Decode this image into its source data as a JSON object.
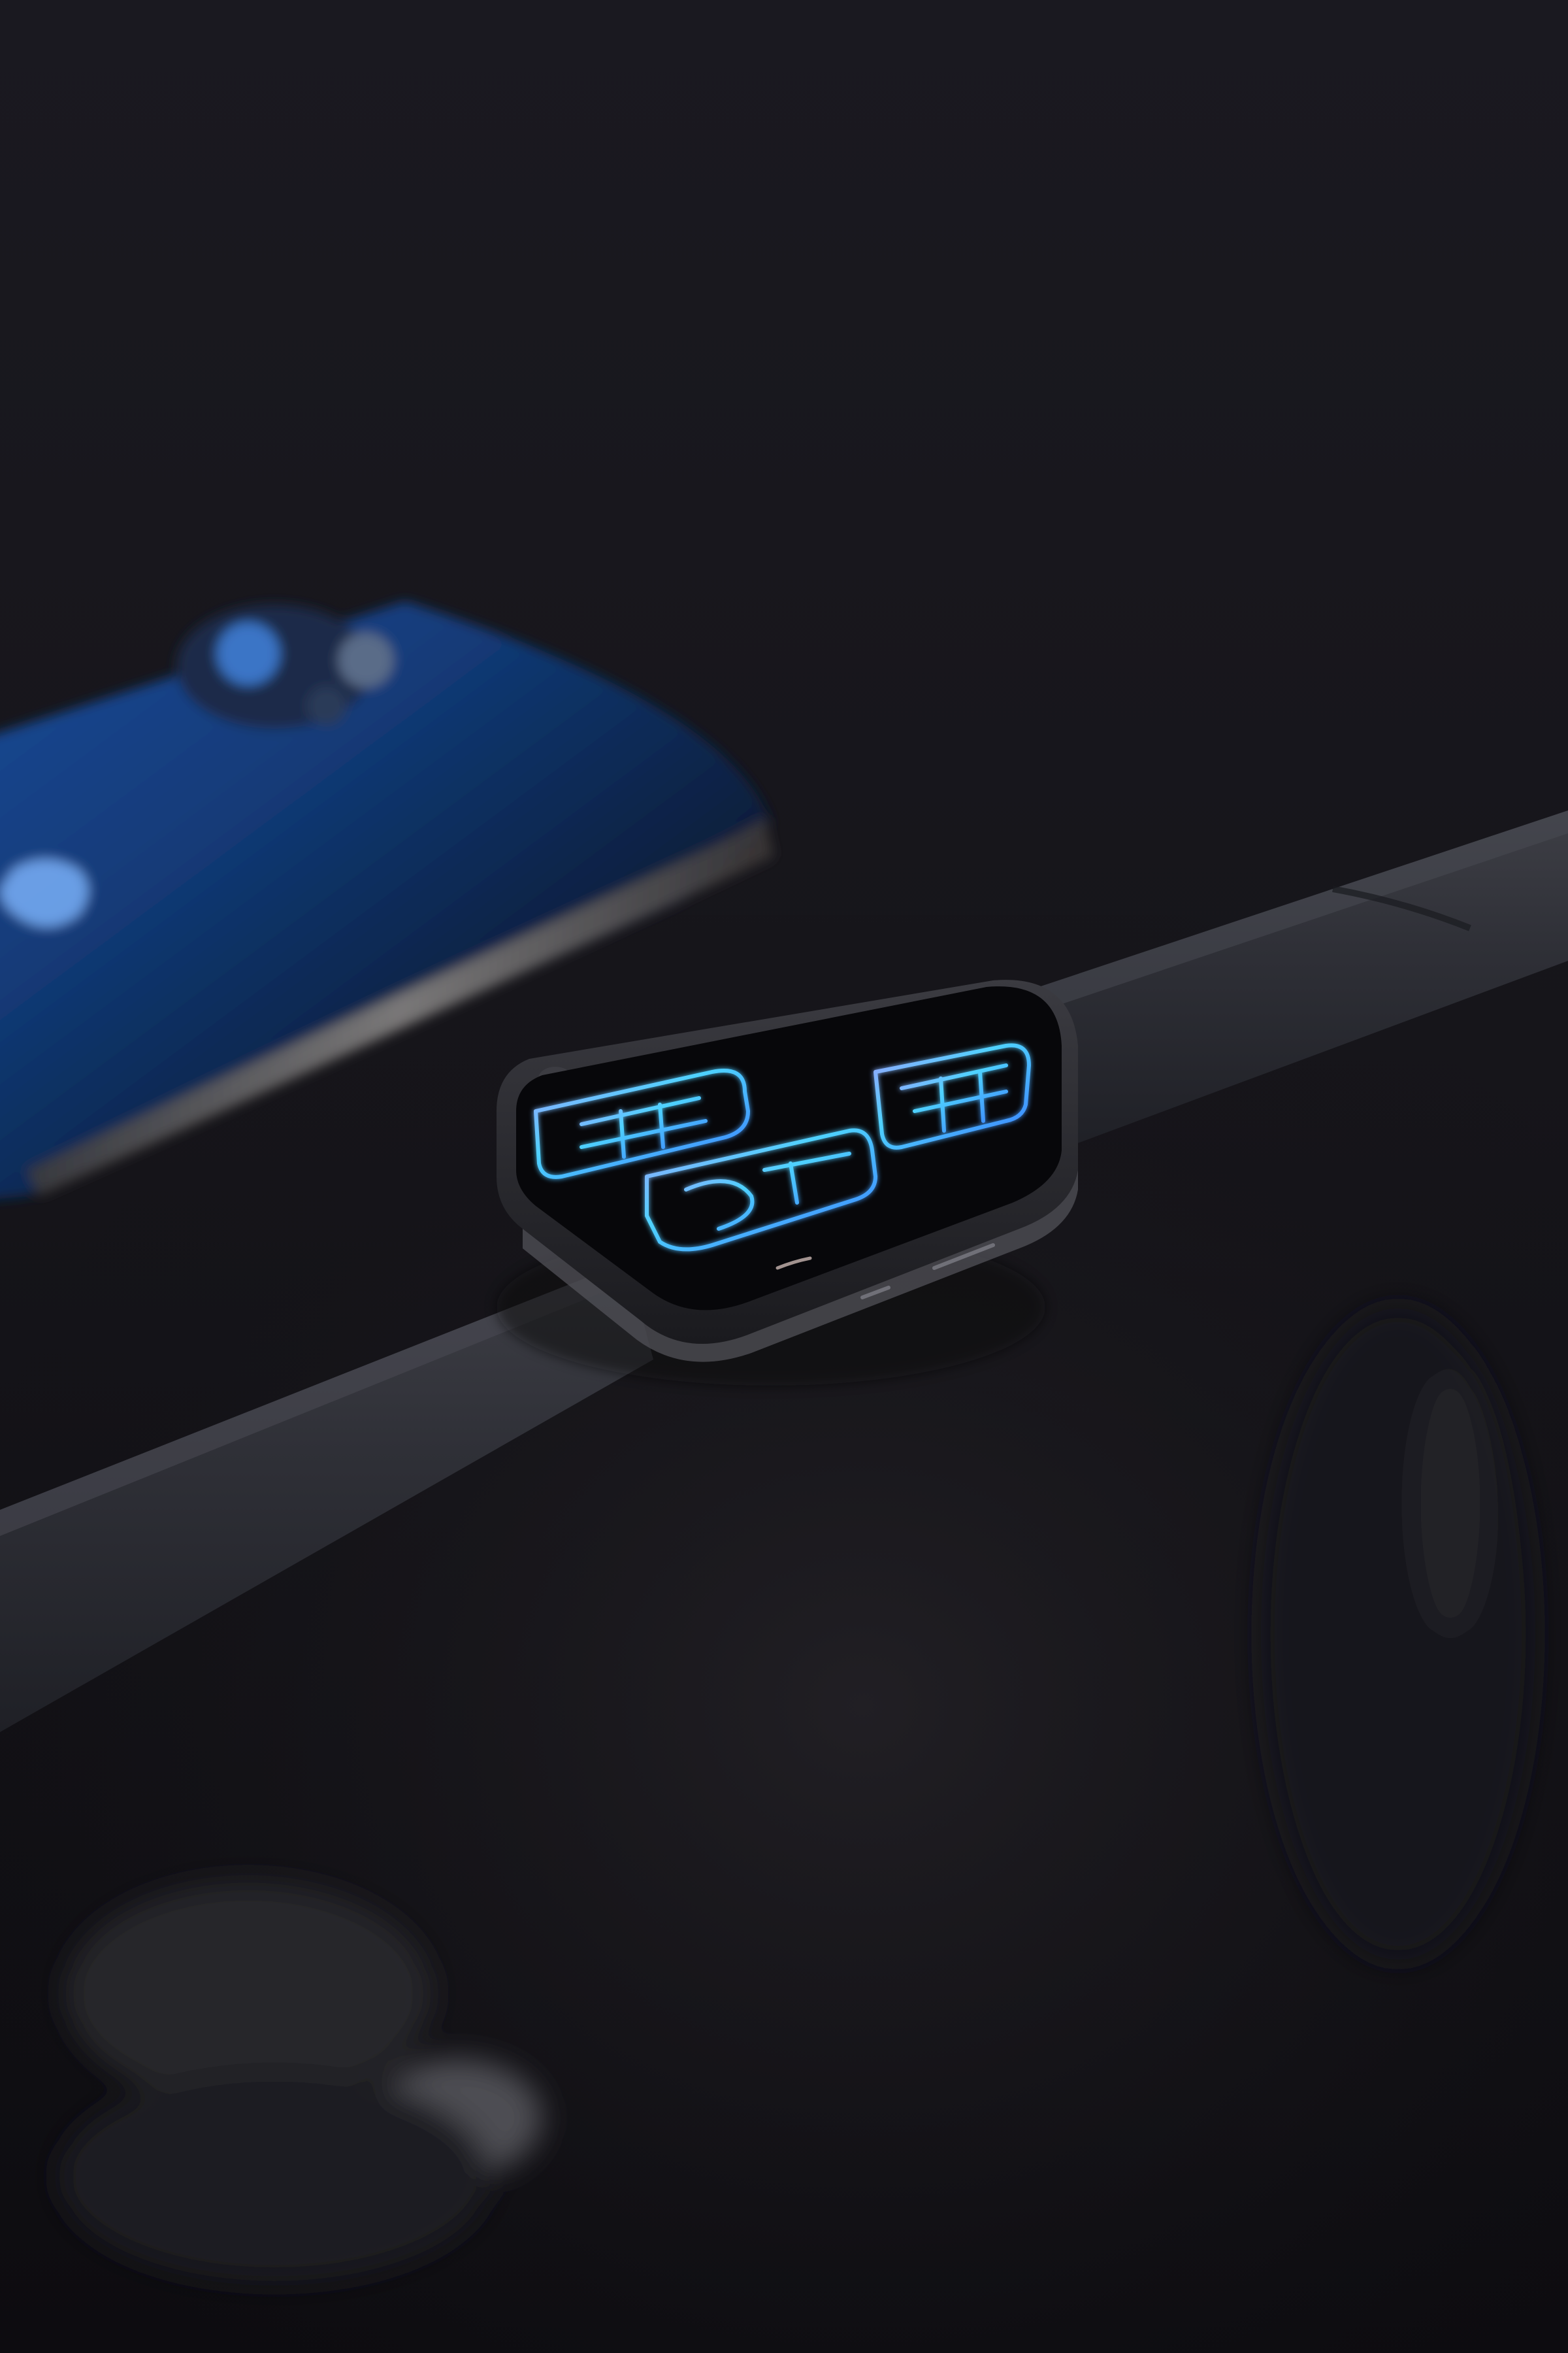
{
  "scene": {
    "subject": "smartwatch-on-dark-surface",
    "colors": {
      "background_top": "#18171d",
      "background_bottom": "#0f0e12",
      "surface": "#1d1b20",
      "band": "#2f3037",
      "band_highlight": "#4a4b53",
      "watch_case": "#2a2a2f",
      "watch_case_edge": "#55565c",
      "watch_screen": "#08080b",
      "neon_cyan": "#4fd2ff",
      "neon_blue": "#3a7bff",
      "neon_violet": "#a9a6ff",
      "phone_glow": "#1f5fbf",
      "phone_edge": "#8a8580"
    },
    "icons": {
      "watch_face": "neon-numeral-watch-face",
      "phone_logo": "apple-logo-icon",
      "camera": "camera-lens-cluster-icon"
    }
  }
}
